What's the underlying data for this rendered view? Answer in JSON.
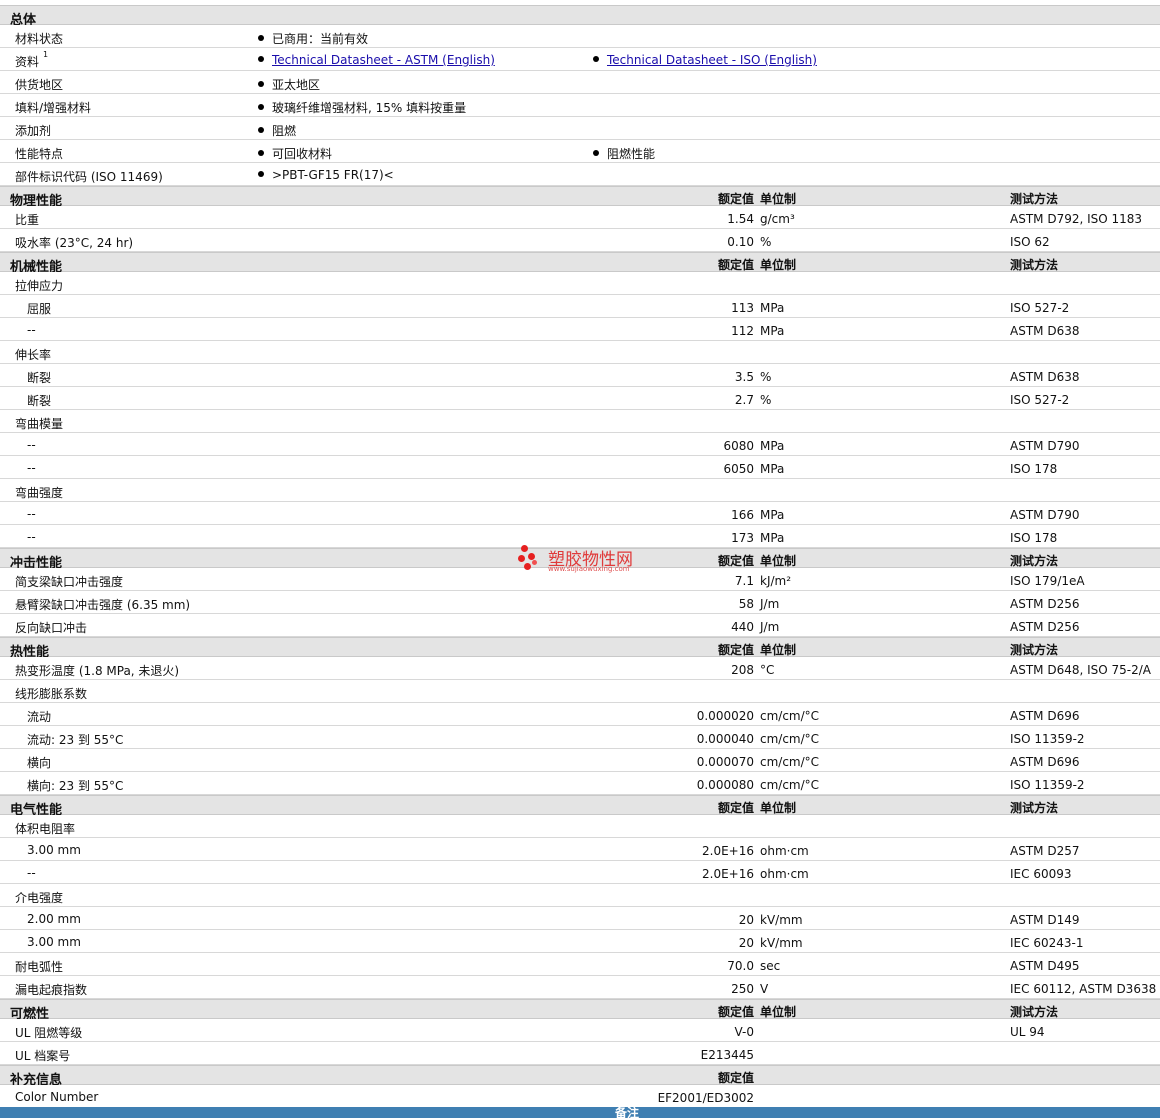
{
  "headers": {
    "value": "额定值",
    "unit": "单位制",
    "method": "测试方法"
  },
  "general": {
    "title": "总体",
    "rows": [
      {
        "label": "材料状态",
        "bullets": [
          "已商用：当前有效"
        ]
      },
      {
        "label": "资料",
        "sup": "1",
        "links": [
          "Technical Datasheet - ASTM (English)",
          "Technical Datasheet - ISO (English)"
        ]
      },
      {
        "label": "供货地区",
        "bullets": [
          "亚太地区"
        ]
      },
      {
        "label": "填料/增强材料",
        "bullets": [
          "玻璃纤维增强材料, 15% 填料按重量"
        ]
      },
      {
        "label": "添加剂",
        "bullets": [
          "阻燃"
        ]
      },
      {
        "label": "性能特点",
        "bullets": [
          "可回收材料",
          "阻燃性能"
        ]
      },
      {
        "label": "部件标识代码 (ISO 11469)",
        "bullets": [
          ">PBT-GF15 FR(17)<"
        ]
      }
    ]
  },
  "physical": {
    "title": "物理性能",
    "rows": [
      {
        "label": "比重",
        "value": "1.54",
        "unit": "g/cm³",
        "method": "ASTM D792, ISO 1183"
      },
      {
        "label": "吸水率 (23°C, 24 hr)",
        "value": "0.10",
        "unit": "%",
        "method": "ISO 62"
      }
    ]
  },
  "mechanical": {
    "title": "机械性能",
    "rows": [
      {
        "label": "拉伸应力",
        "value": "",
        "unit": "",
        "method": ""
      },
      {
        "label": "屈服",
        "sub": true,
        "value": "113",
        "unit": "MPa",
        "method": "ISO 527-2"
      },
      {
        "label": "--",
        "sub": true,
        "value": "112",
        "unit": "MPa",
        "method": "ASTM D638"
      },
      {
        "label": "伸长率",
        "value": "",
        "unit": "",
        "method": ""
      },
      {
        "label": "断裂",
        "sub": true,
        "value": "3.5",
        "unit": "%",
        "method": "ASTM D638"
      },
      {
        "label": "断裂",
        "sub": true,
        "value": "2.7",
        "unit": "%",
        "method": "ISO 527-2"
      },
      {
        "label": "弯曲模量",
        "value": "",
        "unit": "",
        "method": ""
      },
      {
        "label": "--",
        "sub": true,
        "value": "6080",
        "unit": "MPa",
        "method": "ASTM D790"
      },
      {
        "label": "--",
        "sub": true,
        "value": "6050",
        "unit": "MPa",
        "method": "ISO 178"
      },
      {
        "label": "弯曲强度",
        "value": "",
        "unit": "",
        "method": ""
      },
      {
        "label": "--",
        "sub": true,
        "value": "166",
        "unit": "MPa",
        "method": "ASTM D790"
      },
      {
        "label": "--",
        "sub": true,
        "value": "173",
        "unit": "MPa",
        "method": "ISO 178"
      }
    ]
  },
  "impact": {
    "title": "冲击性能",
    "rows": [
      {
        "label": "简支梁缺口冲击强度",
        "value": "7.1",
        "unit": "kJ/m²",
        "method": "ISO 179/1eA"
      },
      {
        "label": "悬臂梁缺口冲击强度 (6.35 mm)",
        "value": "58",
        "unit": "J/m",
        "method": "ASTM D256"
      },
      {
        "label": "反向缺口冲击",
        "value": "440",
        "unit": "J/m",
        "method": "ASTM D256"
      }
    ]
  },
  "thermal": {
    "title": "热性能",
    "rows": [
      {
        "label": "热变形温度 (1.8 MPa, 未退火)",
        "value": "208",
        "unit": "°C",
        "method": "ASTM D648, ISO 75-2/A"
      },
      {
        "label": "线形膨胀系数",
        "value": "",
        "unit": "",
        "method": ""
      },
      {
        "label": "流动",
        "sub": true,
        "value": "0.000020",
        "unit": "cm/cm/°C",
        "method": "ASTM D696"
      },
      {
        "label": "流动: 23 到 55°C",
        "sub": true,
        "value": "0.000040",
        "unit": "cm/cm/°C",
        "method": "ISO 11359-2"
      },
      {
        "label": "横向",
        "sub": true,
        "value": "0.000070",
        "unit": "cm/cm/°C",
        "method": "ASTM D696"
      },
      {
        "label": "横向: 23 到 55°C",
        "sub": true,
        "value": "0.000080",
        "unit": "cm/cm/°C",
        "method": "ISO 11359-2"
      }
    ]
  },
  "electrical": {
    "title": "电气性能",
    "rows": [
      {
        "label": "体积电阻率",
        "value": "",
        "unit": "",
        "method": ""
      },
      {
        "label": "3.00 mm",
        "sub": true,
        "value": "2.0E+16",
        "unit": "ohm·cm",
        "method": "ASTM D257"
      },
      {
        "label": "--",
        "sub": true,
        "value": "2.0E+16",
        "unit": "ohm·cm",
        "method": "IEC 60093"
      },
      {
        "label": "介电强度",
        "value": "",
        "unit": "",
        "method": ""
      },
      {
        "label": "2.00 mm",
        "sub": true,
        "value": "20",
        "unit": "kV/mm",
        "method": "ASTM D149"
      },
      {
        "label": "3.00 mm",
        "sub": true,
        "value": "20",
        "unit": "kV/mm",
        "method": "IEC 60243-1"
      },
      {
        "label": "耐电弧性",
        "value": "70.0",
        "unit": "sec",
        "method": "ASTM D495"
      },
      {
        "label": "漏电起痕指数",
        "value": "250",
        "unit": "V",
        "method": "IEC 60112, ASTM D3638"
      }
    ]
  },
  "flammability": {
    "title": "可燃性",
    "rows": [
      {
        "label": "UL 阻燃等级",
        "value": "V-0",
        "unit": "",
        "method": "UL 94"
      },
      {
        "label": "UL 档案号",
        "value": "E213445",
        "unit": "",
        "method": ""
      }
    ]
  },
  "supplement": {
    "title": "补充信息",
    "rows": [
      {
        "label": "Color Number",
        "value": "EF2001/ED3002",
        "unit": "",
        "method": ""
      }
    ]
  },
  "footer": {
    "label": "备注"
  },
  "watermark": {
    "name": "塑胶物性网",
    "url": "www.sujiaowuxing.com"
  }
}
